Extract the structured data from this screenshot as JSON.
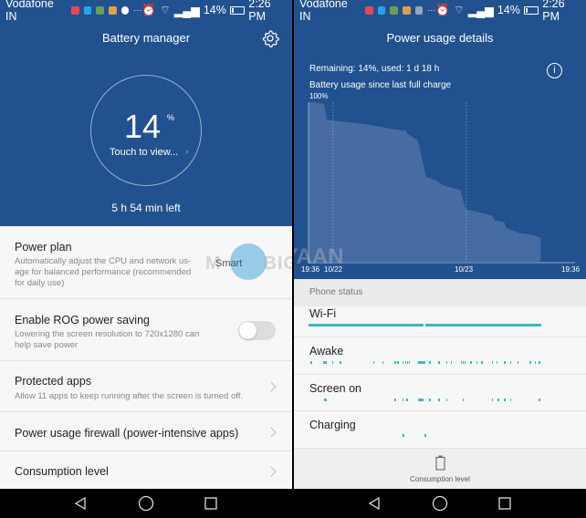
{
  "status_bar": {
    "carrier": "Vodafone IN",
    "more": "···",
    "battery": "14%",
    "battery_level": 0.14,
    "time": "2:26 PM"
  },
  "left": {
    "title": "Battery manager",
    "percent": "14",
    "percent_sign": "%",
    "touch_label": "Touch to view...",
    "time_left": "5 h 54 min left",
    "items": [
      {
        "title": "Power plan",
        "desc": "Automatically adjust the CPU and network us-age for balanced performance (recommended for daily use)",
        "value": "Smart"
      },
      {
        "title": "Enable ROG power saving",
        "desc": "Lowering the screen resolution to 720x1280 can help save power",
        "toggle": false
      },
      {
        "title": "Protected apps",
        "desc": "Allow 11 apps to keep running after the screen is turned off."
      },
      {
        "title": "Power usage firewall (power-intensive apps)"
      },
      {
        "title": "Consumption level"
      }
    ],
    "watermark": "MOBIGYAAN"
  },
  "right": {
    "title": "Power usage details",
    "remaining": "Remaining: 14%, used: 1 d 18 h",
    "chart_title": "Battery usage since last full charge",
    "section_header": "Phone status",
    "bottom_button": "Consumption level",
    "status_rows": [
      {
        "label": "Wi-Fi",
        "ranges": [
          [
            "10/21 19:36",
            "10/22 16:20"
          ],
          [
            "10/22 16:40",
            "10/23 13:30"
          ]
        ]
      },
      {
        "label": "Awake",
        "ticks": [
          "10/21 20:00",
          "10/21 22:10",
          "10/21 22:24",
          "10/21 22:40",
          "10/21 23:48",
          "10/22 01:12",
          "10/22 07:12",
          "10/22 08:54",
          "10/22 11:06",
          "10/22 11:36",
          "10/22 12:30",
          "10/22 13:00",
          "10/22 13:20",
          "10/22 13:40",
          "10/22 15:20",
          "10/22 15:40",
          "10/22 16:00",
          "10/22 16:20",
          "10/22 17:18",
          "10/22 19:00",
          "10/22 20:24",
          "10/22 21:12",
          "10/22 23:00",
          "10/22 23:20",
          "10/22 23:40",
          "10/23 00:42",
          "10/23 01:48",
          "10/23 02:42",
          "10/23 04:36",
          "10/23 05:24",
          "10/23 06:48",
          "10/23 07:54",
          "10/23 09:12",
          "10/23 11:24",
          "10/23 12:18",
          "10/23 13:06"
        ]
      },
      {
        "label": "Screen on",
        "ticks": [
          "10/21 22:24",
          "10/21 22:40",
          "10/22 11:06",
          "10/22 12:30",
          "10/22 13:12",
          "10/22 15:20",
          "10/22 15:40",
          "10/22 16:00",
          "10/22 17:18",
          "10/22 19:00",
          "10/22 20:24",
          "10/22 23:20",
          "10/23 04:36",
          "10/23 05:40",
          "10/23 06:48",
          "10/23 07:54",
          "10/23 13:06"
        ]
      },
      {
        "label": "Charging",
        "ticks": [
          "10/22 12:36",
          "10/22 16:30"
        ]
      }
    ]
  },
  "colors": {
    "primary": "#22518f",
    "chart_fill": "#4a6fa5",
    "status_bar": "#3bb9be"
  },
  "chart_data": {
    "type": "area",
    "title": "Battery usage since last full charge",
    "ylabel": "100%",
    "ylim": [
      0,
      100
    ],
    "xlim": [
      "10/21 19:36",
      "10/23 19:36"
    ],
    "x_tick_labels": [
      "19:36",
      "10/22",
      "10/23",
      "19:36"
    ],
    "points": [
      [
        "10/21 19:46",
        100
      ],
      [
        "10/21 22:24",
        99
      ],
      [
        "10/21 22:54",
        89
      ],
      [
        "10/22 06:06",
        86
      ],
      [
        "10/22 12:42",
        82
      ],
      [
        "10/22 12:54",
        83
      ],
      [
        "10/22 13:30",
        80
      ],
      [
        "10/22 15:18",
        76
      ],
      [
        "10/22 16:48",
        53
      ],
      [
        "10/22 18:30",
        51
      ],
      [
        "10/22 19:48",
        48
      ],
      [
        "10/22 22:54",
        45
      ],
      [
        "10/22 23:54",
        33
      ],
      [
        "10/23 02:18",
        31
      ],
      [
        "10/23 04:36",
        29
      ],
      [
        "10/23 05:06",
        26
      ],
      [
        "10/23 06:48",
        25
      ],
      [
        "10/23 07:18",
        21
      ],
      [
        "10/23 09:36",
        18
      ],
      [
        "10/23 11:42",
        17
      ],
      [
        "10/23 13:24",
        15
      ]
    ],
    "grid": false
  }
}
